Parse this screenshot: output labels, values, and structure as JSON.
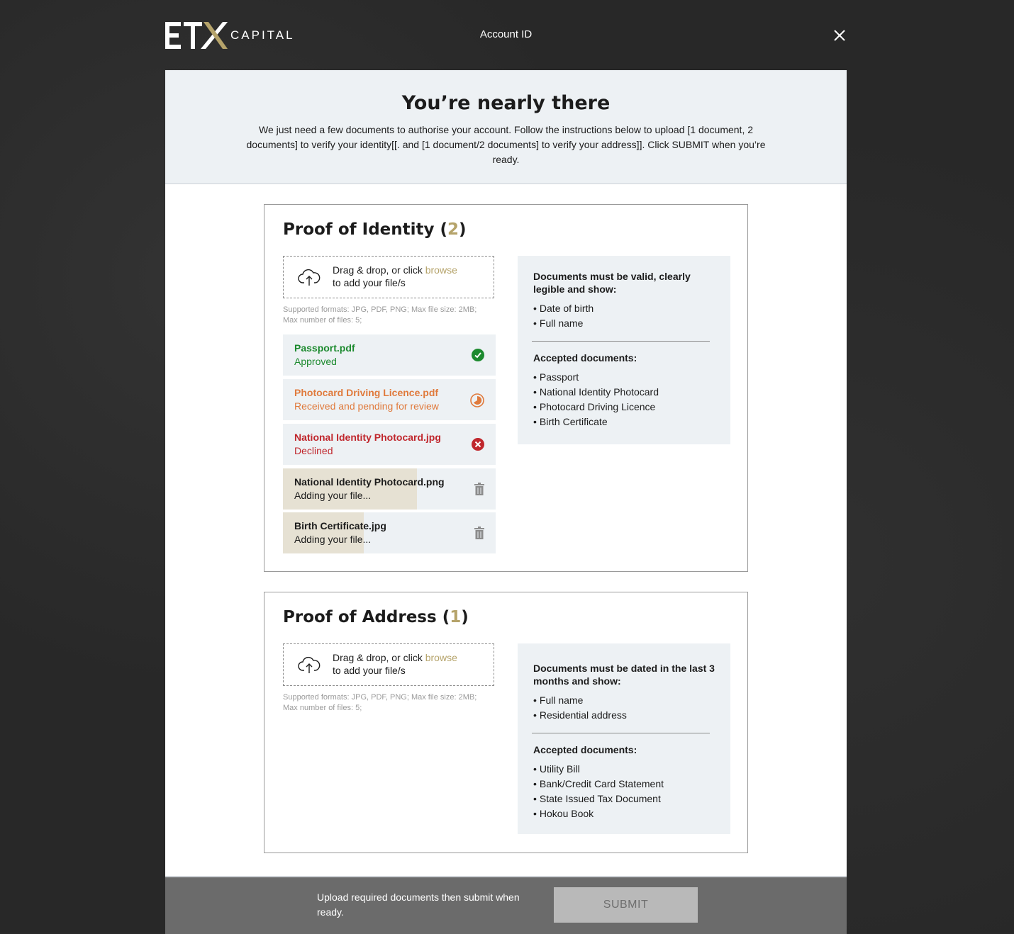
{
  "header": {
    "logo_text": "CAPITAL",
    "title": "Account ID"
  },
  "hero": {
    "title": "You’re nearly there",
    "description": "We just need a few documents to authorise your account. Follow the instructions below to upload [1 document, 2 documents] to verify your identity[[. and [1 document/2 documents] to verify your address]]. Click SUBMIT when you’re ready."
  },
  "identity": {
    "title": "Proof of Identity",
    "count": "2",
    "dropzone": {
      "text_prefix": "Drag & drop, or click",
      "browse": "browse",
      "text_suffix": "to add your file/s"
    },
    "formats": "Supported formats: JPG, PDF, PNG; Max file size: 2MB;",
    "max_files": "Max number of files: 5;",
    "files": [
      {
        "name": "Passport.pdf",
        "status": "Approved",
        "state": "approved"
      },
      {
        "name": "Photocard Driving Licence.pdf",
        "status": "Received and pending for review",
        "state": "pending"
      },
      {
        "name": "National Identity Photocard.jpg",
        "status": "Declined",
        "state": "declined"
      },
      {
        "name": "National Identity Photocard.png",
        "status": "Adding your file...",
        "state": "adding",
        "progress": 0.63
      },
      {
        "name": "Birth Certificate.jpg",
        "status": "Adding your file...",
        "state": "adding",
        "progress": 0.38
      }
    ],
    "requirements_heading": "Documents must be valid, clearly legible and show:",
    "requirements": [
      "Date of birth",
      "Full name"
    ],
    "accepted_heading": "Accepted documents:",
    "accepted": [
      "Passport",
      "National Identity Photocard",
      "Photocard Driving Licence",
      "Birth Certificate"
    ]
  },
  "address": {
    "title": "Proof of Address",
    "count": "1",
    "dropzone": {
      "text_prefix": "Drag & drop, or click",
      "browse": "browse",
      "text_suffix": "to add your file/s"
    },
    "formats": "Supported formats: JPG, PDF, PNG; Max file size: 2MB;",
    "max_files": "Max number of files: 5;",
    "requirements_heading": "Documents must be dated in the last 3 months and show:",
    "requirements": [
      "Full name",
      "Residential address"
    ],
    "accepted_heading": "Accepted documents:",
    "accepted": [
      "Utility Bill",
      "Bank/Credit Card Statement",
      "State Issued Tax Document",
      "Hokou Book"
    ]
  },
  "footer": {
    "text": "Upload required documents then submit when ready.",
    "submit_label": "SUBMIT"
  },
  "colors": {
    "accent_gold": "#b5a36a",
    "approved": "#1c8a2e",
    "pending": "#e07a3c",
    "declined": "#c0272d"
  }
}
